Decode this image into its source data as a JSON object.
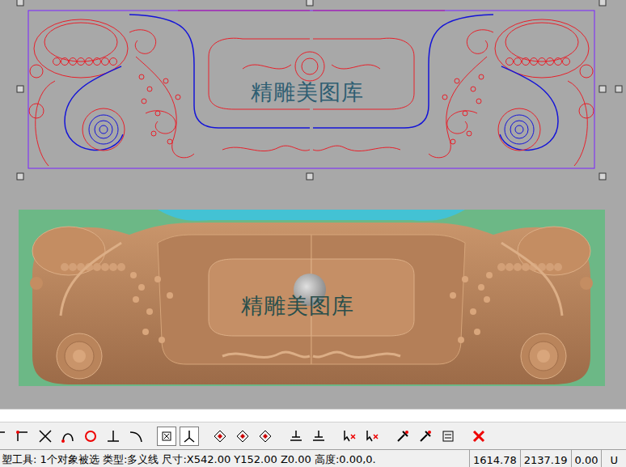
{
  "canvas": {
    "watermark_top": "精雕美图库",
    "watermark_bottom": "精雕美图库"
  },
  "toolbar": [
    {
      "selected": false
    },
    {
      "selected": false
    },
    {
      "selected": false
    },
    {
      "selected": false
    },
    {
      "selected": false
    },
    {
      "selected": false
    },
    {
      "selected": false
    },
    {
      "selected": true
    },
    {
      "selected": true
    },
    {
      "selected": false
    },
    {
      "selected": false
    },
    {
      "selected": false
    },
    {
      "selected": false
    },
    {
      "selected": false
    },
    {
      "selected": false
    },
    {
      "selected": false
    },
    {
      "selected": false
    },
    {
      "selected": false
    },
    {
      "selected": false
    },
    {
      "selected": false
    }
  ],
  "status_bar": {
    "text": "塑工具: 1个对象被选 类型:多义线 尺寸:X542.00 Y152.00 Z0.00 高度:0.00,0.",
    "coords": [
      "1614.78",
      "2137.19",
      "0.00"
    ],
    "tail": "U"
  }
}
